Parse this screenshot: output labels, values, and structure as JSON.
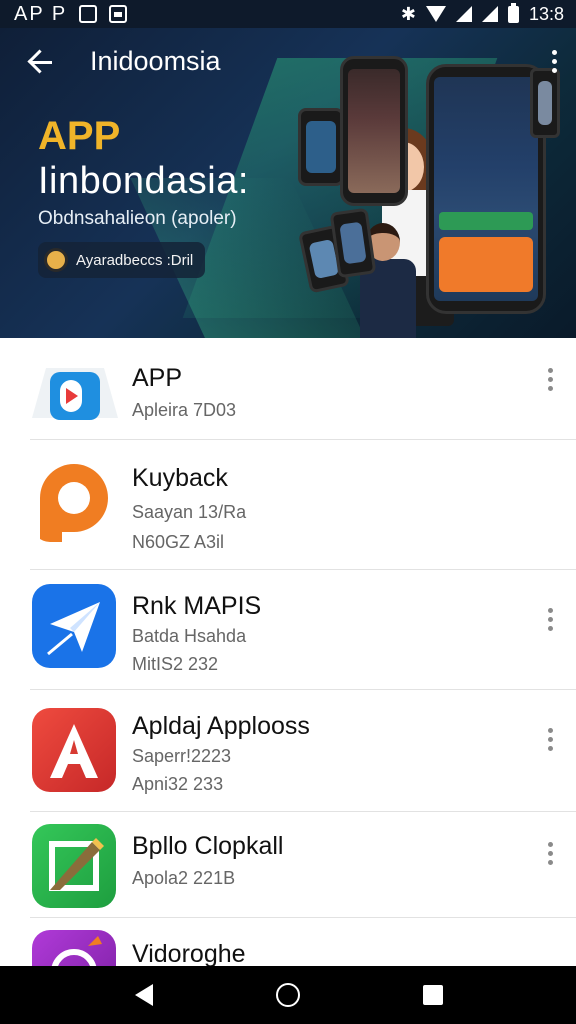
{
  "status_bar": {
    "app_label": "AP P",
    "time": "13:8"
  },
  "app_bar": {
    "title": "Inidoomsia",
    "back_icon": "arrow-left-icon",
    "more_icon": "more-vertical-icon"
  },
  "banner": {
    "title_line1": "APP",
    "title_line2": "Iinbondasia:",
    "subtitle": "Obdnsahalieon (apoler)",
    "chip_label": "Ayaradbeccs :Dril"
  },
  "apps": [
    {
      "title": "APP",
      "line1": "Apleira 7D03",
      "line2": "",
      "icon": "play-d-icon",
      "colors": [
        "#ffffff",
        "#1f8fe0",
        "#e83a3a"
      ]
    },
    {
      "title": "Kuyback",
      "line1": "Saayan 13/Ra",
      "line2": "N60GZ A3il",
      "icon": "orange-p-icon",
      "colors": [
        "#f07d22"
      ]
    },
    {
      "title": "Rnk MAPIS",
      "line1": "Batda Hsahda",
      "line2": "MitIS2 232",
      "icon": "paper-plane-icon",
      "colors": [
        "#1a73e8"
      ]
    },
    {
      "title": "Apldaj Applooss",
      "line1": "Saperr!2223",
      "line2": "Apni32 233",
      "icon": "letter-a-icon",
      "colors": [
        "#e53935"
      ]
    },
    {
      "title": "Bpllo Clopkall",
      "line1": "Apola2 221B",
      "line2": "",
      "icon": "green-pen-icon",
      "colors": [
        "#2bb24c"
      ]
    },
    {
      "title": "Vidoroghe",
      "line1": "",
      "line2": "",
      "icon": "purple-camera-icon",
      "colors": [
        "#9b35c9"
      ]
    }
  ],
  "nav_bar": {
    "back": "nav-back-icon",
    "home": "nav-home-icon",
    "recents": "nav-recents-icon"
  }
}
